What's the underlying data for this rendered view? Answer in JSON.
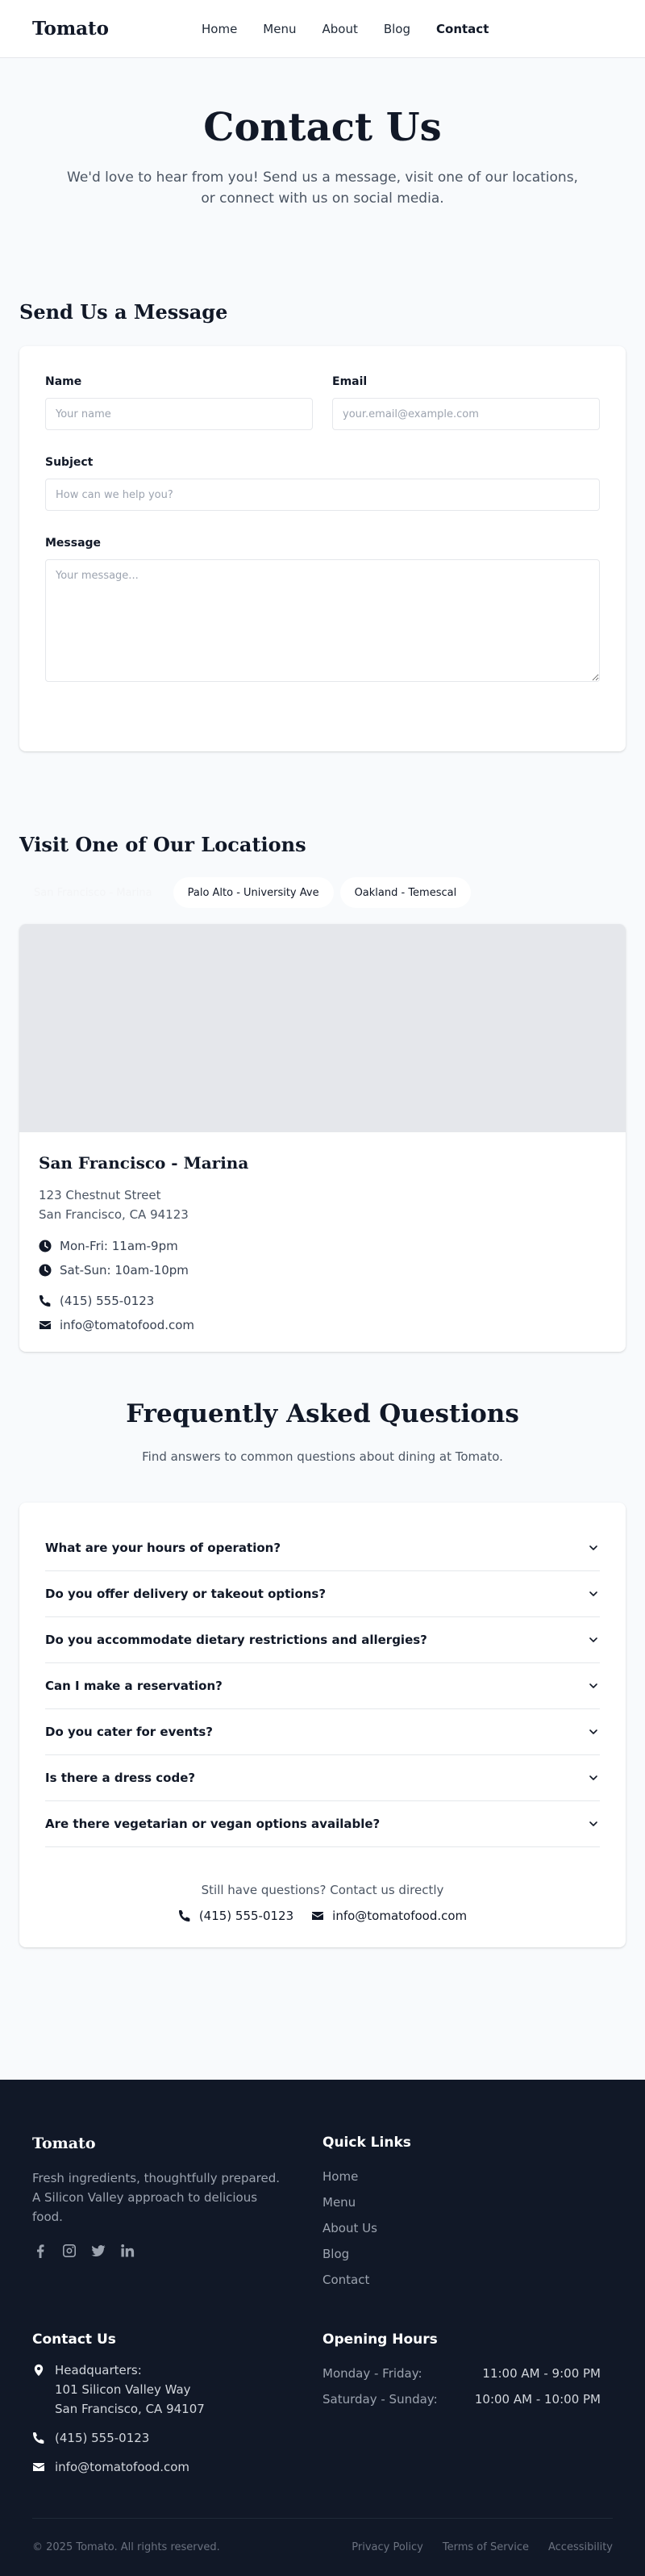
{
  "header": {
    "logo": "Tomato",
    "nav": [
      "Home",
      "Menu",
      "About",
      "Blog",
      "Contact"
    ]
  },
  "hero": {
    "title": "Contact Us",
    "subtitle": "We'd love to hear from you! Send us a message, visit one of our locations, or connect with us on social media."
  },
  "form": {
    "title": "Send Us a Message",
    "name_label": "Name",
    "name_placeholder": "Your name",
    "email_label": "Email",
    "email_placeholder": "your.email@example.com",
    "subject_label": "Subject",
    "subject_placeholder": "How can we help you?",
    "message_label": "Message",
    "message_placeholder": "Your message..."
  },
  "locations": {
    "title": "Visit One of Our Locations",
    "tabs": [
      "San Francisco - Marina",
      "Palo Alto - University Ave",
      "Oakland - Temescal"
    ],
    "active": {
      "name": "San Francisco - Marina",
      "address1": "123 Chestnut Street",
      "address2": "San Francisco, CA 94123",
      "hours_weekday": "Mon-Fri: 11am-9pm",
      "hours_weekend": "Sat-Sun: 10am-10pm",
      "phone": "(415) 555-0123",
      "email": "info@tomatofood.com"
    }
  },
  "faq": {
    "title": "Frequently Asked Questions",
    "subtitle": "Find answers to common questions about dining at Tomato.",
    "items": [
      "What are your hours of operation?",
      "Do you offer delivery or takeout options?",
      "Do you accommodate dietary restrictions and allergies?",
      "Can I make a reservation?",
      "Do you cater for events?",
      "Is there a dress code?",
      "Are there vegetarian or vegan options available?"
    ],
    "still_questions": "Still have questions? Contact us directly",
    "phone": "(415) 555-0123",
    "email": "info@tomatofood.com"
  },
  "footer": {
    "logo": "Tomato",
    "tagline": "Fresh ingredients, thoughtfully prepared. A Silicon Valley approach to delicious food.",
    "socials": [
      "facebook-icon",
      "instagram-icon",
      "twitter-icon",
      "linkedin-icon"
    ],
    "quick_links_title": "Quick Links",
    "quick_links": [
      "Home",
      "Menu",
      "About Us",
      "Blog",
      "Contact"
    ],
    "contact_title": "Contact Us",
    "hq_label": "Headquarters:",
    "hq_line1": "101 Silicon Valley Way",
    "hq_line2": "San Francisco, CA 94107",
    "phone": "(415) 555-0123",
    "email": "info@tomatofood.com",
    "hours_title": "Opening Hours",
    "hours": [
      {
        "days": "Monday - Friday:",
        "time": "11:00 AM - 9:00 PM"
      },
      {
        "days": "Saturday - Sunday:",
        "time": "10:00 AM - 10:00 PM"
      }
    ],
    "copyright": "© 2025 Tomato. All rights reserved.",
    "legal": [
      "Privacy Policy",
      "Terms of Service",
      "Accessibility"
    ]
  },
  "colors": {
    "background": "#f8fafc",
    "text": "#111827",
    "muted": "#4b5563",
    "footer_bg": "#111827"
  }
}
